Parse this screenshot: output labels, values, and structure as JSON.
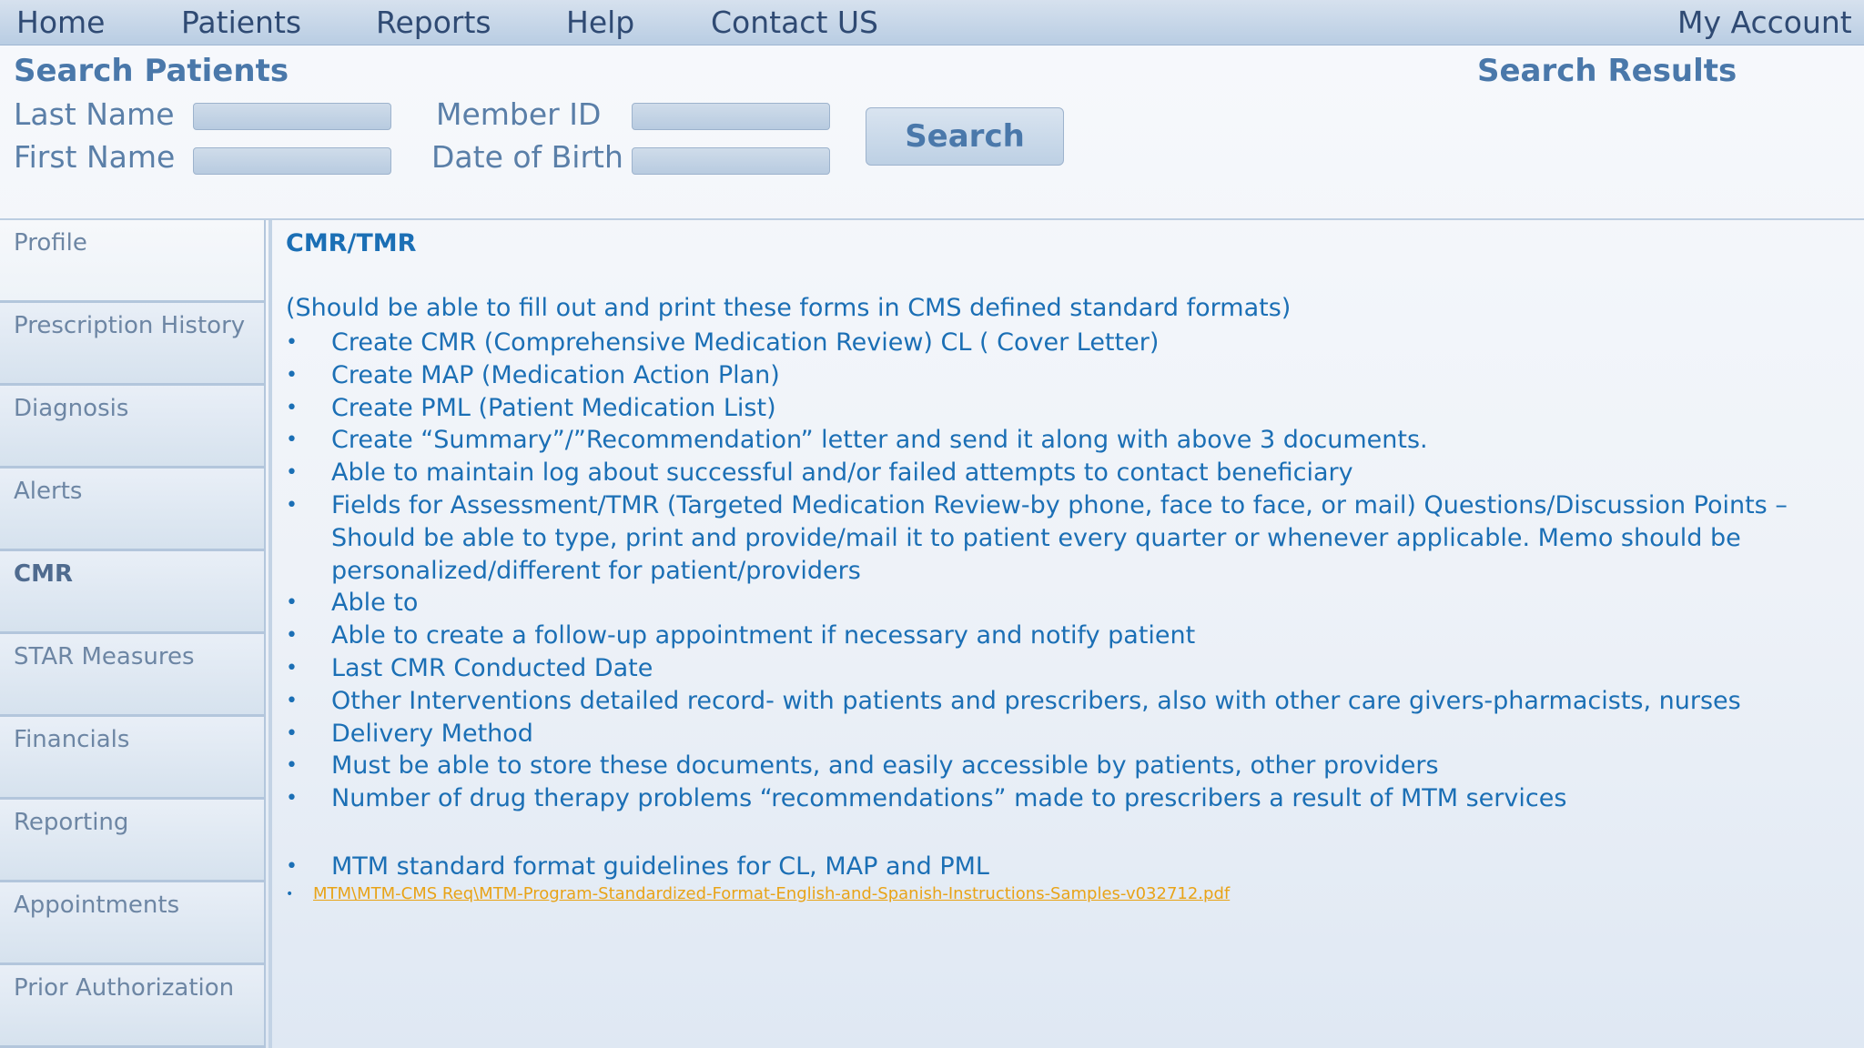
{
  "nav": {
    "home": "Home",
    "patients": "Patients",
    "reports": "Reports",
    "help": "Help",
    "contact": "Contact US",
    "account": "My Account"
  },
  "search": {
    "title": "Search Patients",
    "results_title": "Search Results",
    "last_name_label": "Last Name",
    "first_name_label": "First Name",
    "member_id_label": "Member ID",
    "dob_label": "Date of Birth",
    "last_name_value": "",
    "first_name_value": "",
    "member_id_value": "",
    "dob_value": "",
    "button_label": "Search"
  },
  "sidebar": {
    "items": [
      {
        "label": "Profile"
      },
      {
        "label": "Prescription History"
      },
      {
        "label": "Diagnosis"
      },
      {
        "label": "Alerts"
      },
      {
        "label": "CMR"
      },
      {
        "label": "STAR Measures"
      },
      {
        "label": "Financials"
      },
      {
        "label": "Reporting"
      },
      {
        "label": "Appointments"
      },
      {
        "label": "Prior Authorization"
      }
    ],
    "active": "CMR"
  },
  "content": {
    "title": "CMR/TMR",
    "note": "(Should be able to fill out and print these forms in CMS defined standard formats)",
    "bullet": "•",
    "requirements": [
      "Create CMR (Comprehensive Medication Review) CL ( Cover Letter)",
      "Create MAP (Medication Action Plan)",
      "Create PML (Patient Medication List)",
      "Create “Summary”/”Recommendation” letter and send it along with above 3 documents.",
      "Able to maintain log about successful and/or failed attempts to contact beneficiary",
      "Fields for Assessment/TMR (Targeted Medication Review-by phone, face to face, or mail) Questions/Discussion Points – Should be able to type, print and provide/mail it to patient every quarter or whenever applicable. Memo should be personalized/different for patient/providers",
      "Able to",
      "Able to create a follow-up appointment if necessary and notify patient",
      "Last CMR Conducted Date",
      "Other Interventions detailed record- with patients and prescribers, also with other care givers-pharmacists, nurses",
      "Delivery Method",
      "Must be able to store these documents, and easily accessible by patients, other providers",
      "Number of drug therapy problems “recommendations” made to prescribers a result of MTM services"
    ],
    "mtm_guidelines": "MTM standard format guidelines for CL, MAP and PML",
    "link_text": "MTM\\MTM-CMS Req\\MTM-Program-Standardized-Format-English-and-Spanish-Instructions-Samples-v032712.pdf"
  }
}
